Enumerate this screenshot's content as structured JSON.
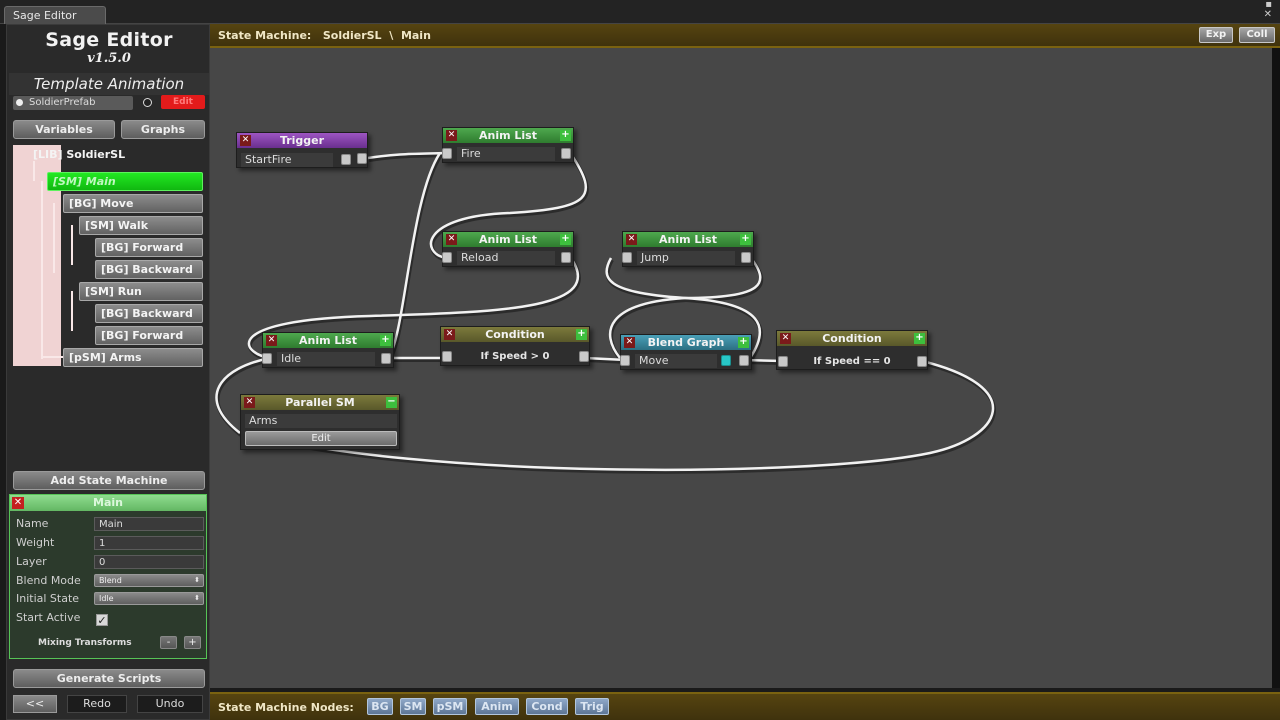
{
  "window": {
    "title": "Sage Editor",
    "controls": [
      "▪",
      "✕"
    ]
  },
  "sidebar": {
    "app_title": "Sage Editor",
    "version": "v1.5.0",
    "section_title": "Template Animation",
    "prefab": "SoldierPrefab",
    "edit_button": "Edit",
    "tabs": {
      "variables": "Variables",
      "graphs": "Graphs"
    },
    "tree": {
      "root": "[LIB] SoldierSL",
      "items": [
        {
          "label": "[SM] Main"
        },
        {
          "label": "[BG] Move"
        },
        {
          "label": "[SM] Walk"
        },
        {
          "label": "[BG] Forward"
        },
        {
          "label": "[BG] Backward"
        },
        {
          "label": "[SM] Run"
        },
        {
          "label": "[BG] Backward"
        },
        {
          "label": "[BG] Forward"
        },
        {
          "label": "[pSM] Arms"
        }
      ]
    },
    "add_state_machine": "Add State Machine",
    "inspector": {
      "title": "Main",
      "name_label": "Name",
      "name_value": "Main",
      "weight_label": "Weight",
      "weight_value": "1",
      "layer_label": "Layer",
      "layer_value": "0",
      "blend_mode_label": "Blend Mode",
      "blend_mode_value": "Blend",
      "initial_state_label": "Initial State",
      "initial_state_value": "Idle",
      "start_active_label": "Start Active",
      "start_active_checked": true,
      "mixing_label": "Mixing Transforms",
      "mixing_minus": "-",
      "mixing_plus": "+"
    },
    "generate_scripts": "Generate Scripts",
    "bottom": {
      "back": "<<",
      "redo": "Redo",
      "undo": "Undo"
    }
  },
  "header": {
    "label": "State Machine:",
    "machine": "SoldierSL",
    "separator": "\\",
    "current": "Main",
    "expand": "Exp",
    "collapse": "Coll"
  },
  "footer": {
    "label": "State Machine Nodes:",
    "buttons": [
      "BG",
      "SM",
      "pSM",
      "Anim",
      "Cond",
      "Trig"
    ]
  },
  "graph": {
    "trigger": {
      "title": "Trigger",
      "field": "StartFire"
    },
    "anim_fire": {
      "title": "Anim List",
      "field": "Fire"
    },
    "anim_reload": {
      "title": "Anim List",
      "field": "Reload"
    },
    "anim_jump": {
      "title": "Anim List",
      "field": "Jump"
    },
    "anim_idle": {
      "title": "Anim List",
      "field": "Idle"
    },
    "cond1": {
      "title": "Condition",
      "expr": "If Speed > 0"
    },
    "blend": {
      "title": "Blend Graph",
      "field": "Move"
    },
    "cond2": {
      "title": "Condition",
      "expr": "If Speed == 0"
    },
    "parallel": {
      "title": "Parallel SM",
      "field": "Arms",
      "edit": "Edit"
    }
  },
  "colors": {
    "anim_header": "#3d8f3d",
    "trigger_header": "#7f3fa6",
    "condition_header": "#6b6a33",
    "blend_header": "#3a8aa0",
    "selected_tree": "#19d419",
    "canvas_bg": "#474747"
  }
}
